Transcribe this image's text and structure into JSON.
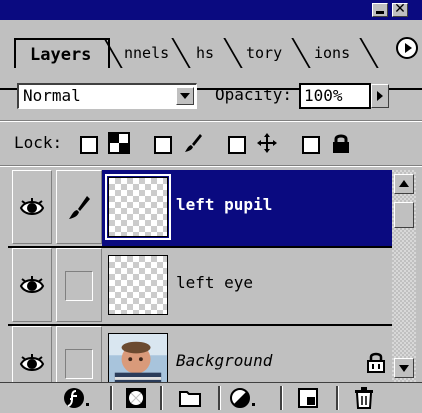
{
  "window": {
    "minimize_icon": "minimize-icon",
    "close_glyph": "✕"
  },
  "tabs": [
    {
      "label": "Layers",
      "active": true
    },
    {
      "label": "nnels",
      "active": false
    },
    {
      "label": "hs",
      "active": false
    },
    {
      "label": "tory",
      "active": false
    },
    {
      "label": "ions",
      "active": false
    }
  ],
  "blend": {
    "mode": "Normal",
    "opacity_label": "Opacity:",
    "opacity_value": "100%"
  },
  "lock": {
    "label": "Lock:",
    "options": [
      "transparency-checker-icon",
      "brush-icon",
      "move-cross-icon",
      "padlock-icon"
    ]
  },
  "layers": [
    {
      "name": "left pupil",
      "selected": true,
      "visible": true,
      "brush": true
    },
    {
      "name": "left eye",
      "selected": false,
      "visible": true,
      "brush": false
    },
    {
      "name": "Background",
      "selected": false,
      "visible": true,
      "brush": false,
      "locked": true
    }
  ],
  "toolbar": {
    "buttons": [
      "layer-style-icon",
      "add-mask-icon",
      "new-set-icon",
      "adjustment-layer-icon",
      "new-layer-icon",
      "trash-icon"
    ]
  },
  "colors": {
    "selection": "#0a0a80",
    "panel": "#c0c0c0"
  }
}
